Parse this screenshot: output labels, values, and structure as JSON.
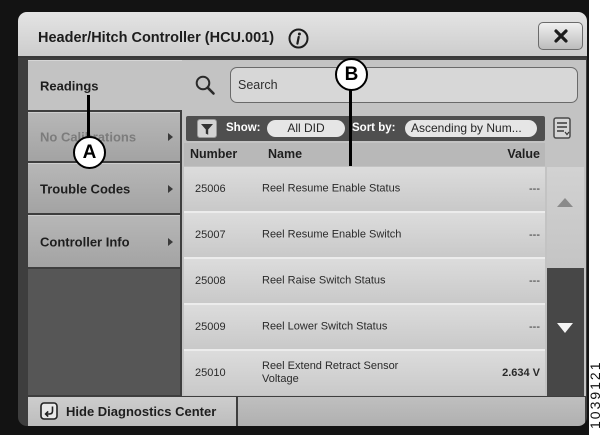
{
  "window": {
    "title": "Header/Hitch Controller (HCU.001)"
  },
  "icons": {
    "info": "info-icon",
    "close": "close-icon",
    "search": "search-icon",
    "filter": "filter-icon",
    "list_options": "list-icon",
    "submenu": "chevron-right-icon",
    "scroll_up": "triangle-up-icon",
    "scroll_down": "triangle-down-icon",
    "hide": "exit-icon"
  },
  "sidebar": {
    "items": [
      {
        "label": "Readings",
        "selected": true,
        "enabled": true,
        "submenu": false
      },
      {
        "label": "No Calibrations",
        "selected": false,
        "enabled": false,
        "submenu": true
      },
      {
        "label": "Trouble Codes",
        "selected": false,
        "enabled": true,
        "submenu": true
      },
      {
        "label": "Controller Info",
        "selected": false,
        "enabled": true,
        "submenu": true
      }
    ]
  },
  "search": {
    "placeholder": "Search"
  },
  "toolbar": {
    "show_label": "Show:",
    "show_value": "All DID",
    "sort_label": "Sort by:",
    "sort_value": "Ascending by Num..."
  },
  "table": {
    "columns": {
      "number": "Number",
      "name": "Name",
      "value": "Value"
    },
    "rows": [
      {
        "number": "25006",
        "name": "Reel Resume Enable Status",
        "value": "---"
      },
      {
        "number": "25007",
        "name": "Reel Resume Enable Switch",
        "value": "---"
      },
      {
        "number": "25008",
        "name": "Reel Raise Switch Status",
        "value": "---"
      },
      {
        "number": "25009",
        "name": "Reel Lower Switch Status",
        "value": "---"
      },
      {
        "number": "25010",
        "name": "Reel Extend Retract Sensor Voltage",
        "value": "2.634 V"
      }
    ]
  },
  "footer": {
    "hide_label": "Hide Diagnostics Center"
  },
  "callouts": {
    "a": "A",
    "b": "B"
  },
  "figure_number": "1039121"
}
